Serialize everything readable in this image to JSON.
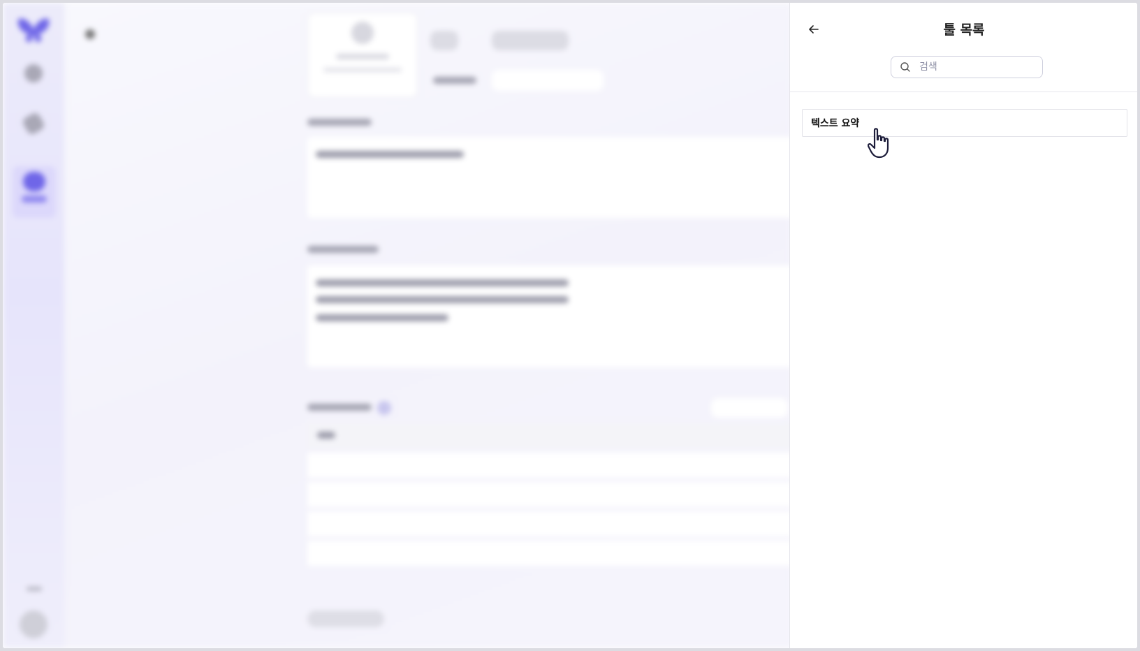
{
  "panel": {
    "title": "툴 목록",
    "back_icon": "arrow-left-icon",
    "search": {
      "placeholder": "검색",
      "value": "",
      "icon": "search-icon"
    },
    "tools": [
      {
        "label": "텍스트 요약"
      }
    ]
  },
  "colors": {
    "brand": "#6f66e8",
    "rail_bg": "#ecebfa",
    "border": "#e2e2e8",
    "text": "#222222"
  }
}
